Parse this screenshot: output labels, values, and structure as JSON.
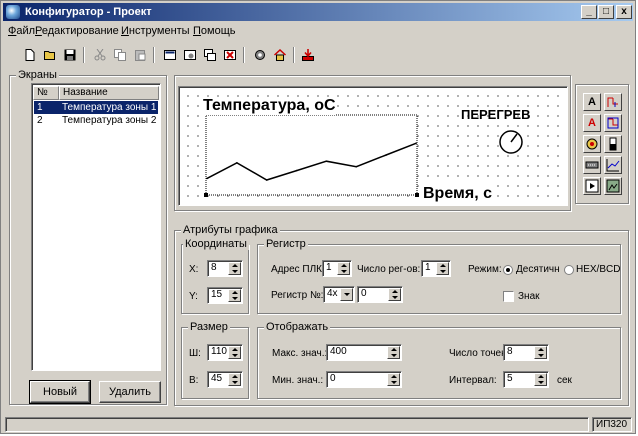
{
  "window": {
    "title": "Конфигуратор - Проект",
    "min": "_",
    "max": "□",
    "close": "x"
  },
  "menu": [
    "Файл",
    "Редактирование",
    "Инструменты",
    "Помощь"
  ],
  "screens": {
    "group_label": "Экраны",
    "col_num": "№",
    "col_name": "Название",
    "rows": [
      {
        "num": "1",
        "name": "Температура зоны 1"
      },
      {
        "num": "2",
        "name": "Температура зоны 2"
      }
    ],
    "new_button": "Новый",
    "delete_button": "Удалить"
  },
  "preview": {
    "title": "Температура, оС",
    "xlabel": "Время, с",
    "overheat": "ПЕРЕГРЕВ",
    "line_color": "#000000"
  },
  "chart_data": {
    "type": "line",
    "title": "Температура, оС",
    "xlabel": "Время, с",
    "ylabel": "",
    "x": [
      0,
      1,
      2,
      3,
      4,
      5,
      6,
      7
    ],
    "values": [
      20,
      40,
      18,
      30,
      42,
      35,
      50,
      65
    ],
    "ylim": [
      0,
      100
    ]
  },
  "palette": {
    "items": [
      "A",
      "A",
      "",
      "",
      "",
      "",
      "",
      "",
      "",
      ""
    ]
  },
  "attrs": {
    "group_label": "Атрибуты графика",
    "coords": {
      "label": "Координаты",
      "x_label": "X:",
      "x_value": "8",
      "y_label": "Y:",
      "y_value": "15"
    },
    "register": {
      "label": "Регистр",
      "plc_label": "Адрес ПЛК",
      "plc_value": "1",
      "regs_label": "Число рег-ов:",
      "regs_value": "1",
      "mode_label": "Режим:",
      "mode_decimal": "Десятичн",
      "mode_hex": "HEX/BCD",
      "reg_no_label": "Регистр №:",
      "reg_type": "4x",
      "reg_no_value": "0",
      "sign_label": "Знак"
    },
    "size": {
      "label": "Размер",
      "w_label": "Ш:",
      "w_value": "110",
      "h_label": "В:",
      "h_value": "45"
    },
    "display": {
      "label": "Отображать",
      "max_label": "Макс. знач.:",
      "max_value": "400",
      "min_label": "Мин. знач.:",
      "min_value": "0",
      "points_label": "Число точек",
      "points_value": "8",
      "interval_label": "Интервал:",
      "interval_value": "5",
      "interval_unit": "сек"
    }
  },
  "status": {
    "device": "ИП320"
  }
}
